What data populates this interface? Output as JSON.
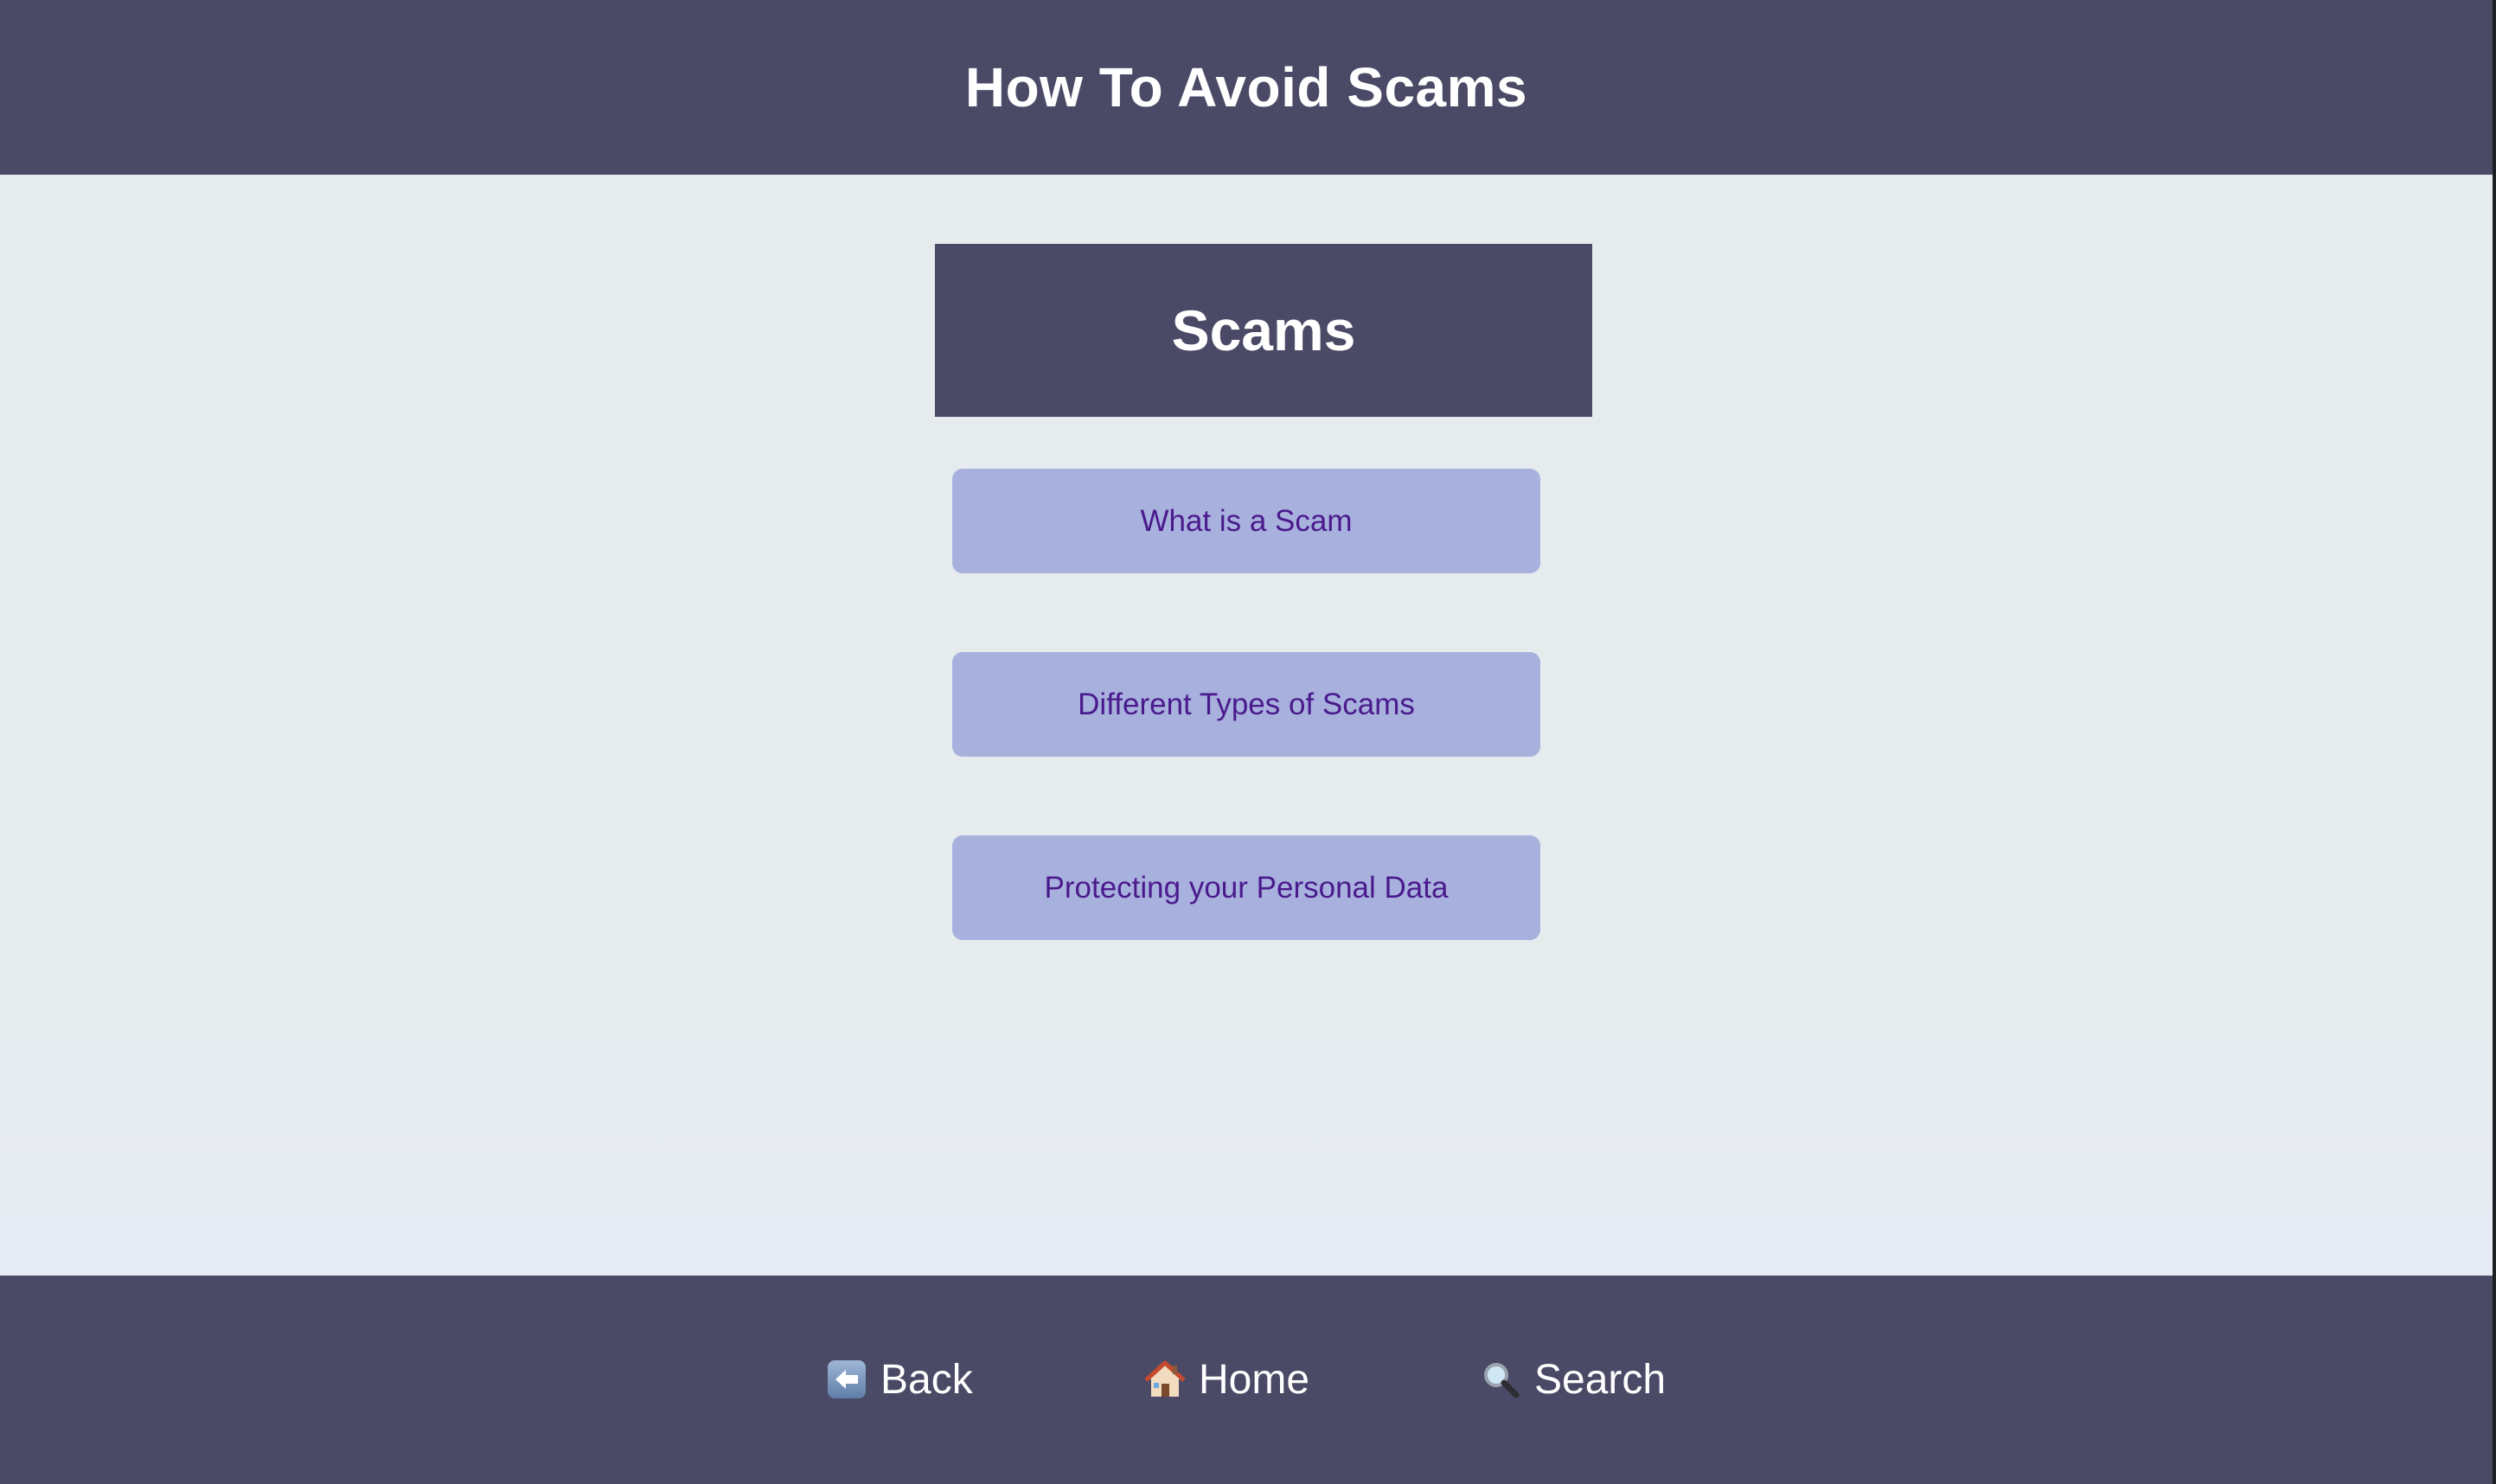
{
  "header": {
    "title": "How To Avoid Scams"
  },
  "section": {
    "title": "Scams"
  },
  "topics": [
    {
      "label": "What is a Scam"
    },
    {
      "label": "Different Types of Scams"
    },
    {
      "label": "Protecting your Personal Data"
    }
  ],
  "nav": {
    "back": {
      "label": "Back",
      "icon": "back-arrow-icon"
    },
    "home": {
      "label": "Home",
      "icon": "house-icon"
    },
    "search": {
      "label": "Search",
      "icon": "magnifier-icon"
    }
  },
  "colors": {
    "header_bg": "#4b4a66",
    "page_bg": "#e6ebee",
    "button_bg": "#a8b0de",
    "button_text": "#4a1a8c"
  }
}
